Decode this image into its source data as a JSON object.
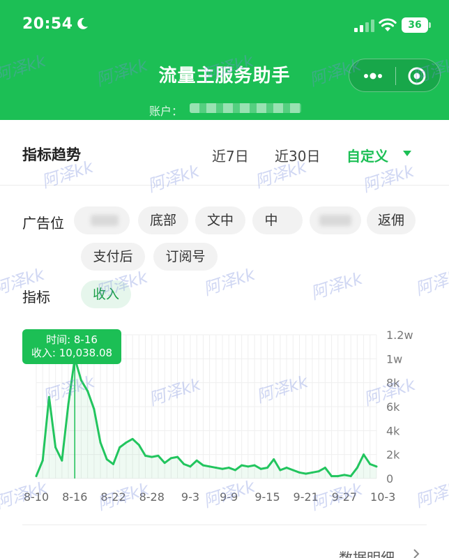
{
  "status_bar": {
    "time": "20:54",
    "battery": "36"
  },
  "header": {
    "title": "流量主服务助手",
    "account_label": "账户："
  },
  "trend": {
    "label": "指标趋势",
    "ranges": [
      "近7日",
      "近30日",
      "自定义"
    ],
    "active_range": "自定义"
  },
  "filters": {
    "placement_label": "广告位",
    "placements": [
      "底部",
      "文中",
      "中",
      "返佣",
      "支付后",
      "订阅号"
    ],
    "metric_label": "指标",
    "metric": "收入"
  },
  "tooltip": {
    "time_line": "时间: 8-16",
    "value_line": "收入: 10,038.08"
  },
  "footer": {
    "detail_link": "数据明细"
  },
  "watermark": "阿泽kk",
  "colors": {
    "brand": "#1cbf55",
    "line": "#22c55e"
  },
  "chart_data": {
    "type": "line",
    "series": [
      {
        "values": [
          200,
          1500,
          6800,
          2600,
          1500,
          6200,
          10038,
          8200,
          7300,
          5800,
          3000,
          1600,
          1200,
          2600,
          3000,
          3300,
          2800,
          1900,
          1800,
          1900,
          1300,
          1700,
          1800,
          1200,
          1000,
          1500,
          1100,
          1000,
          900,
          800,
          900,
          700,
          1100,
          1000,
          1100,
          800,
          900,
          1600,
          700,
          900,
          700,
          500,
          400,
          500,
          600,
          900,
          200,
          200,
          300,
          200,
          900,
          2000,
          1200,
          1000
        ]
      }
    ],
    "x_tick_labels": [
      "8-10",
      "8-16",
      "8-22",
      "8-28",
      "9-3",
      "9-9",
      "9-15",
      "9-21",
      "9-27",
      "10-3"
    ],
    "y_tick_labels": [
      "0",
      "2k",
      "4k",
      "6k",
      "8k",
      "1w",
      "1.2w"
    ],
    "y_tick_values": [
      0,
      2000,
      4000,
      6000,
      8000,
      10000,
      12000
    ],
    "ylim": [
      0,
      12000
    ],
    "highlight_index": 6,
    "grid": true
  }
}
